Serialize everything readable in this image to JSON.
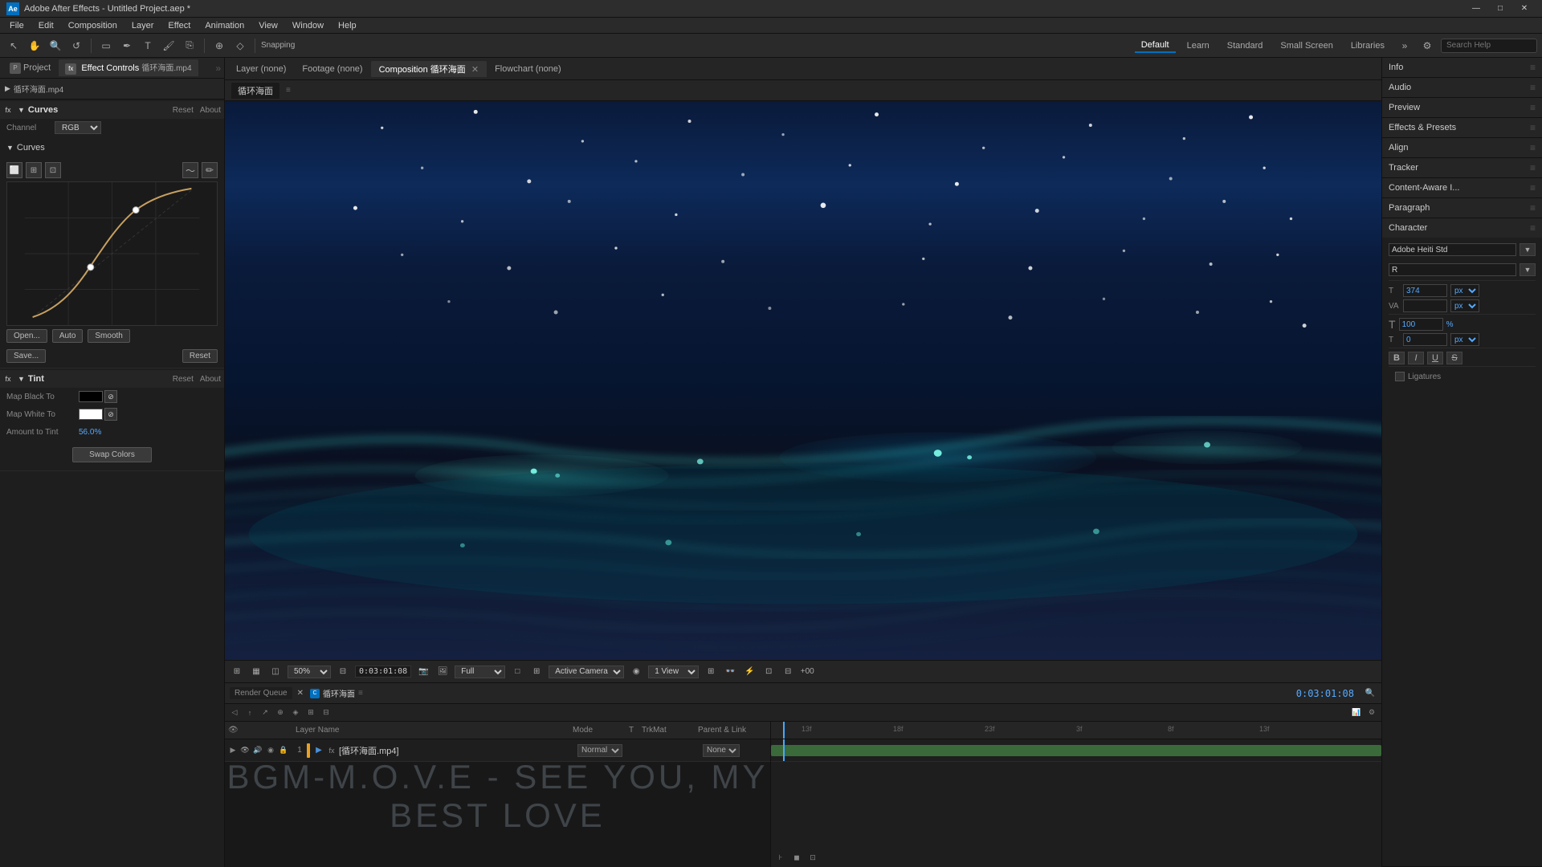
{
  "titlebar": {
    "logo": "Ae",
    "title": "Adobe After Effects - Untitled Project.aep *",
    "minimize": "—",
    "restore": "□",
    "close": "✕"
  },
  "menubar": {
    "items": [
      "File",
      "Edit",
      "Composition",
      "Layer",
      "Effect",
      "Animation",
      "View",
      "Window",
      "Help"
    ]
  },
  "toolbar": {
    "workspace_tabs": [
      "Default",
      "Learn",
      "Standard",
      "Small Screen",
      "Libraries"
    ],
    "active_workspace": "Default",
    "search_placeholder": "Search Help"
  },
  "leftpanel": {
    "project_tab": "Project",
    "ec_tab": "Effect Controls",
    "ec_file": "循环海面.mp4",
    "curves": {
      "title": "Curves",
      "reset": "Reset",
      "about": "About",
      "channel_label": "Channel",
      "channel_value": "RGB",
      "sub_title": "Curves",
      "open_btn": "Open...",
      "auto_btn": "Auto",
      "smooth_btn": "Smooth",
      "save_btn": "Save...",
      "reset_btn": "Reset"
    },
    "tint": {
      "title": "Tint",
      "reset": "Reset",
      "about": "About",
      "map_black_label": "Map Black To",
      "map_white_label": "Map White To",
      "amount_label": "Amount to Tint",
      "amount_value": "56.0%",
      "swap_btn": "Swap Colors"
    }
  },
  "panels_right": {
    "info": "Info",
    "audio": "Audio",
    "preview": "Preview",
    "effects": "Effects & Presets",
    "align": "Align",
    "tracker": "Tracker",
    "content_aware": "Content-Aware I...",
    "paragraph": "Paragraph",
    "character": "Character"
  },
  "character_panel": {
    "font_name": "Adobe Heiti Std",
    "font_style": "R",
    "size_value": "374",
    "size_unit": "px",
    "tracking_value": "",
    "leading_value": "",
    "kern_type": "",
    "scale_h": "100",
    "scale_v": "",
    "baseline": "0",
    "bold_btn": "B",
    "italic_btn": "I",
    "underline_btn": "U",
    "strikethrough_btn": "S",
    "ligatures_label": "Ligatures",
    "ligatures_checked": false,
    "va_label": "VA"
  },
  "view_tabs": {
    "layer": "Layer (none)",
    "footage": "Footage (none)",
    "composition": "Composition 循环海面",
    "flowchart": "Flowchart (none)"
  },
  "composition": {
    "comp_tab": "循环海面",
    "zoom": "50%",
    "time": "0:03:01:08",
    "quality": "Full",
    "camera": "Active Camera",
    "view_count": "1 View"
  },
  "timeline": {
    "render_queue": "Render Queue",
    "comp_tab": "循环海面",
    "current_time": "0:03:01:08",
    "layer_name_col": "Layer Name",
    "mode_col": "Mode",
    "t_col": "T",
    "tritmat_col": "TrkMat",
    "parent_link_col": "Parent & Link",
    "layers": [
      {
        "num": "1",
        "name": "[循环海面.mp4]",
        "mode": "Norma",
        "parent": "None",
        "has_fx": true
      }
    ],
    "time_markers": [
      "13f",
      "18f",
      "23f",
      "3f",
      "8f",
      "13f"
    ]
  },
  "bgm_text": "BGM-M.O.V.E - SEE YOU, MY BEST LOVE",
  "icons": {
    "arrow_right": "▶",
    "arrow_down": "▼",
    "close_x": "✕",
    "search": "🔍",
    "gear": "⚙",
    "eye": "👁",
    "lock": "🔒",
    "chain": "🔗",
    "pencil": "✏",
    "camera": "📷",
    "film": "🎬",
    "wave": "〜"
  }
}
